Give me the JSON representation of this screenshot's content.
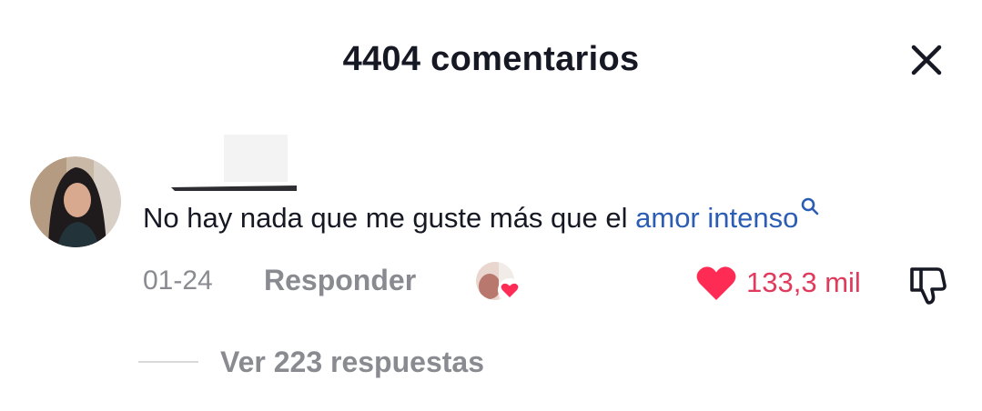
{
  "header": {
    "title": "4404 comentarios",
    "close_icon": "close-icon"
  },
  "comment": {
    "text_before": "No hay nada que me guste más que el ",
    "hashtag": "amor intenso",
    "hashtag_icon": "search-icon",
    "date": "01-24",
    "reply_label": "Responder",
    "creator_liked_icon": "creator-liked-heart-icon",
    "like_count": "133,3 mil",
    "like_icon": "heart-icon",
    "dislike_icon": "thumbs-down-icon",
    "view_replies_label": "Ver 223 respuestas"
  },
  "colors": {
    "text_primary": "#161823",
    "text_secondary": "#8a8b91",
    "link": "#2b5db4",
    "like": "#e03a5c",
    "liked_heart": "#fe2c55"
  }
}
